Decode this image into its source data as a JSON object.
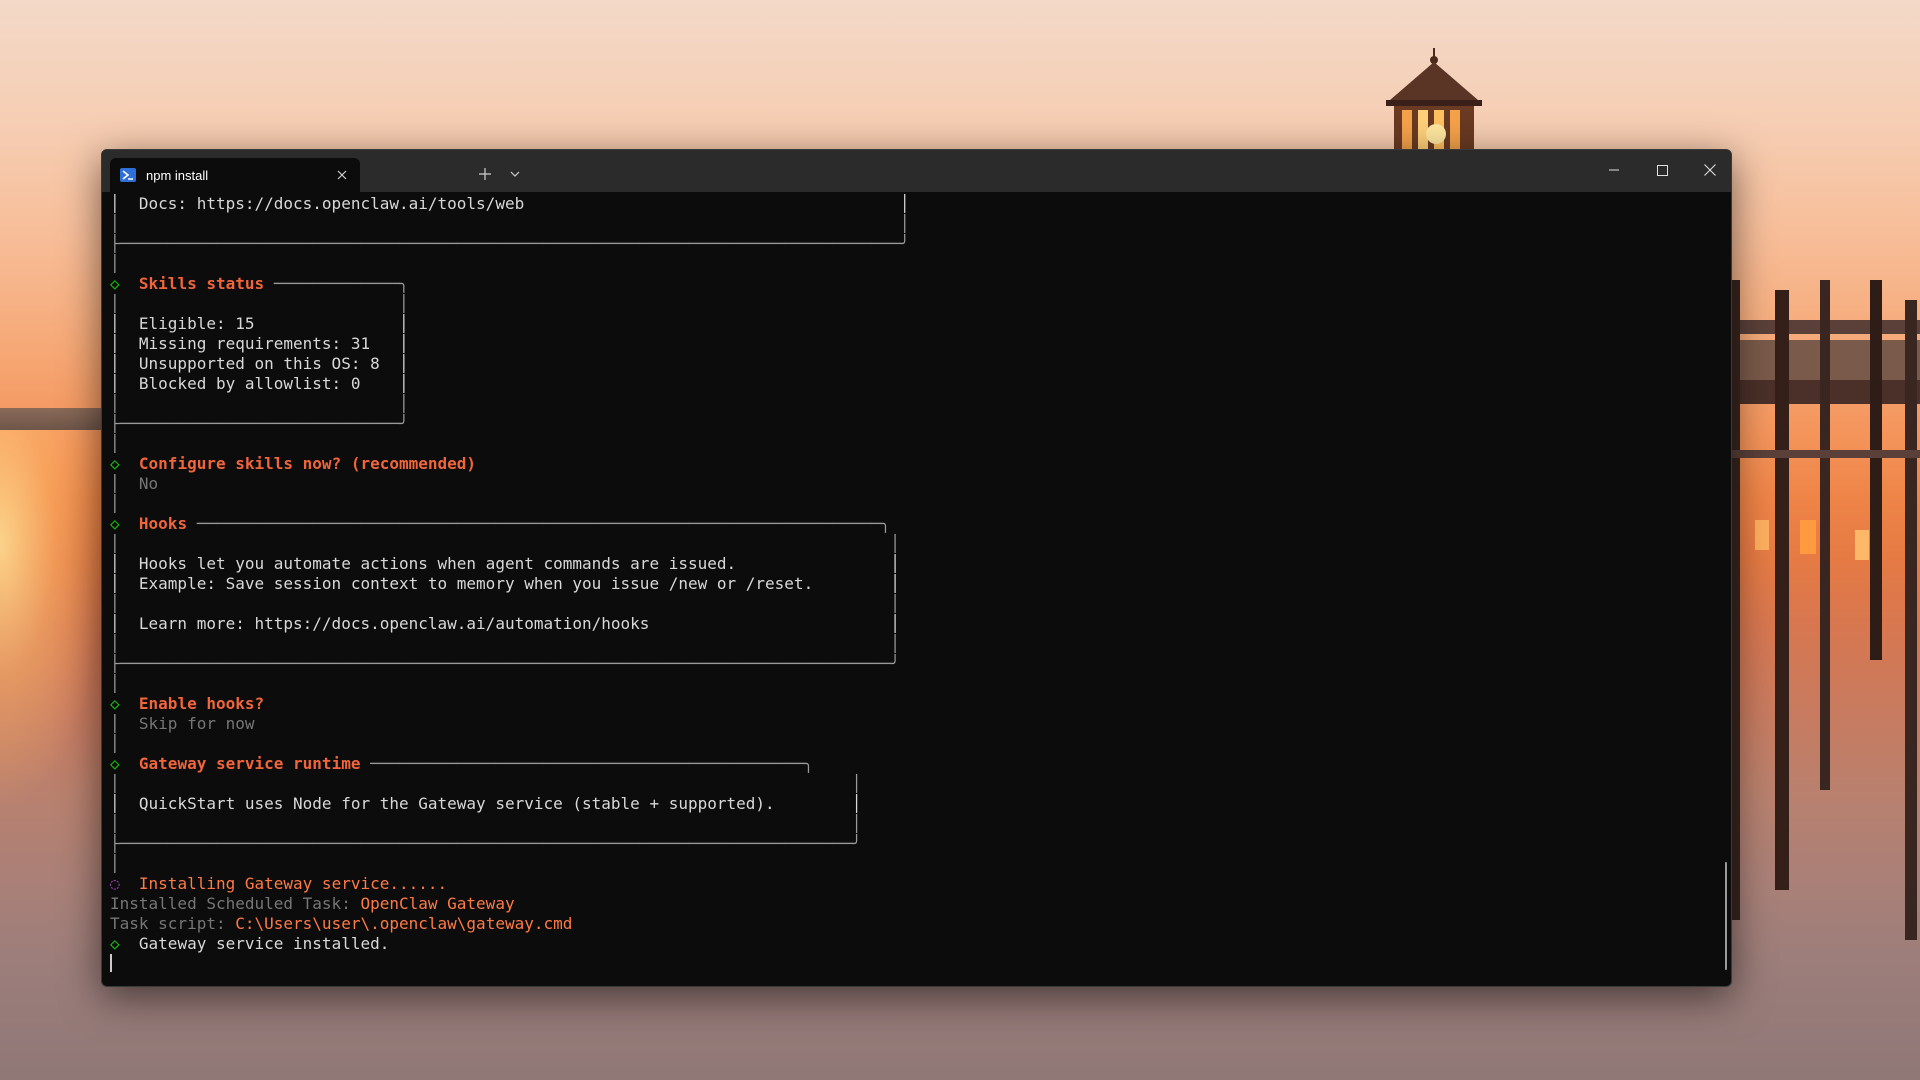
{
  "tab": {
    "title": "npm install",
    "icon": "powershell-icon"
  },
  "window_controls": {
    "minimize_icon": "minimize-icon",
    "maximize_icon": "maximize-icon",
    "close_icon": "close-icon"
  },
  "colors": {
    "terminal_bg": "#0c0c0c",
    "titlebar_bg": "#2b2b2b",
    "heading": "#f0653a",
    "bullet_done": "#16c60c",
    "bullet_progress": "#b148c6",
    "muted": "#767676"
  },
  "terminal": {
    "lines": [
      {
        "parts": [
          {
            "t": "│  Docs: https://docs.openclaw.ai/tools/web                                       │",
            "c": "c-white"
          }
        ]
      },
      {
        "parts": [
          {
            "t": "│                                                                                 │",
            "c": "c-border"
          }
        ]
      },
      {
        "parts": [
          {
            "t": "├─────────────────────────────────────────────────────────────────────────────────╯",
            "c": "c-border"
          }
        ]
      },
      {
        "parts": [
          {
            "t": "│",
            "c": "c-border"
          }
        ]
      },
      {
        "parts": [
          {
            "t": "◇  ",
            "c": "c-green"
          },
          {
            "t": "Skills status",
            "c": "c-orange"
          },
          {
            "t": " ─────────────╮",
            "c": "c-border"
          }
        ]
      },
      {
        "parts": [
          {
            "t": "│                             │",
            "c": "c-border"
          }
        ]
      },
      {
        "parts": [
          {
            "t": "│  Eligible: 15               │",
            "c": "c-white"
          }
        ]
      },
      {
        "parts": [
          {
            "t": "│  Missing requirements: 31   │",
            "c": "c-white"
          }
        ]
      },
      {
        "parts": [
          {
            "t": "│  Unsupported on this OS: 8  │",
            "c": "c-white"
          }
        ]
      },
      {
        "parts": [
          {
            "t": "│  Blocked by allowlist: 0    │",
            "c": "c-white"
          }
        ]
      },
      {
        "parts": [
          {
            "t": "│                             │",
            "c": "c-border"
          }
        ]
      },
      {
        "parts": [
          {
            "t": "├─────────────────────────────╯",
            "c": "c-border"
          }
        ]
      },
      {
        "parts": [
          {
            "t": "│",
            "c": "c-border"
          }
        ]
      },
      {
        "parts": [
          {
            "t": "◇  ",
            "c": "c-green"
          },
          {
            "t": "Configure skills now? (recommended)",
            "c": "c-orange"
          }
        ]
      },
      {
        "parts": [
          {
            "t": "│  ",
            "c": "c-border"
          },
          {
            "t": "No",
            "c": "c-dim"
          }
        ]
      },
      {
        "parts": [
          {
            "t": "│",
            "c": "c-border"
          }
        ]
      },
      {
        "parts": [
          {
            "t": "◇  ",
            "c": "c-green"
          },
          {
            "t": "Hooks",
            "c": "c-orange"
          },
          {
            "t": " ───────────────────────────────────────────────────────────────────────╮",
            "c": "c-border"
          }
        ]
      },
      {
        "parts": [
          {
            "t": "│                                                                                │",
            "c": "c-border"
          }
        ]
      },
      {
        "parts": [
          {
            "t": "│  Hooks let you automate actions when agent commands are issued.                │",
            "c": "c-white"
          }
        ]
      },
      {
        "parts": [
          {
            "t": "│  Example: Save session context to memory when you issue /new or /reset.        │",
            "c": "c-white"
          }
        ]
      },
      {
        "parts": [
          {
            "t": "│                                                                                │",
            "c": "c-border"
          }
        ]
      },
      {
        "parts": [
          {
            "t": "│  Learn more: https://docs.openclaw.ai/automation/hooks                         │",
            "c": "c-white"
          }
        ]
      },
      {
        "parts": [
          {
            "t": "│                                                                                │",
            "c": "c-border"
          }
        ]
      },
      {
        "parts": [
          {
            "t": "├────────────────────────────────────────────────────────────────────────────────╯",
            "c": "c-border"
          }
        ]
      },
      {
        "parts": [
          {
            "t": "│",
            "c": "c-border"
          }
        ]
      },
      {
        "parts": [
          {
            "t": "◇  ",
            "c": "c-green"
          },
          {
            "t": "Enable hooks?",
            "c": "c-orange"
          }
        ]
      },
      {
        "parts": [
          {
            "t": "│  ",
            "c": "c-border"
          },
          {
            "t": "Skip for now",
            "c": "c-dim"
          }
        ]
      },
      {
        "parts": [
          {
            "t": "│",
            "c": "c-border"
          }
        ]
      },
      {
        "parts": [
          {
            "t": "◇  ",
            "c": "c-green"
          },
          {
            "t": "Gateway service runtime",
            "c": "c-orange"
          },
          {
            "t": " ─────────────────────────────────────────────╮",
            "c": "c-border"
          }
        ]
      },
      {
        "parts": [
          {
            "t": "│                                                                            │",
            "c": "c-border"
          }
        ]
      },
      {
        "parts": [
          {
            "t": "│  QuickStart uses Node for the Gateway service (stable + supported).        │",
            "c": "c-white"
          }
        ]
      },
      {
        "parts": [
          {
            "t": "│                                                                            │",
            "c": "c-border"
          }
        ]
      },
      {
        "parts": [
          {
            "t": "├────────────────────────────────────────────────────────────────────────────╯",
            "c": "c-border"
          }
        ]
      },
      {
        "parts": [
          {
            "t": "│",
            "c": "c-border"
          }
        ]
      },
      {
        "parts": [
          {
            "t": "◌  ",
            "c": "c-purple"
          },
          {
            "t": "Installing Gateway service......",
            "c": "c-orange-n"
          }
        ]
      },
      {
        "parts": [
          {
            "t": "Installed Scheduled Task: ",
            "c": "c-dim"
          },
          {
            "t": "OpenClaw Gateway",
            "c": "c-orange-n"
          }
        ]
      },
      {
        "parts": [
          {
            "t": "Task script: ",
            "c": "c-dim"
          },
          {
            "t": "C:\\Users\\user\\.openclaw\\gateway.cmd",
            "c": "c-orange-n"
          }
        ]
      },
      {
        "parts": [
          {
            "t": "◇  ",
            "c": "c-green"
          },
          {
            "t": "Gateway service installed.",
            "c": "c-white"
          }
        ]
      }
    ]
  }
}
